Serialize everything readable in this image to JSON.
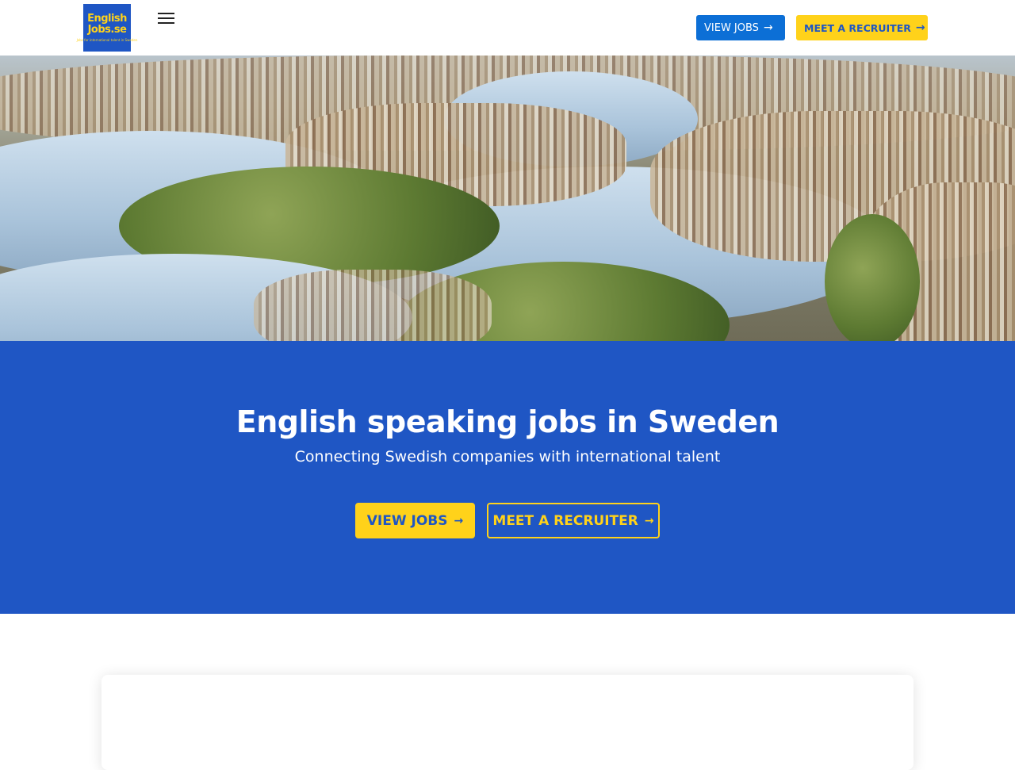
{
  "header": {
    "logo": {
      "line1": "English",
      "line2": "Jobs.se",
      "tagline": "Jobs for international talent in Sweden"
    },
    "view_jobs_label": "VIEW JOBS",
    "meet_recruiter_label": "MEET A RECRUITER"
  },
  "hero": {
    "image": "aerial-city-waterfront-photo"
  },
  "banner": {
    "title": "English speaking jobs in Sweden",
    "subtitle": "Connecting Swedish companies with international talent",
    "view_jobs_label": "VIEW JOBS",
    "meet_recruiter_label": "MEET A RECRUITER"
  },
  "icons": {
    "arrow": "→",
    "menu": "hamburger-menu-icon"
  },
  "colors": {
    "brand_blue": "#1f56c4",
    "button_blue": "#0c6fd6",
    "brand_yellow": "#ffd21a"
  }
}
